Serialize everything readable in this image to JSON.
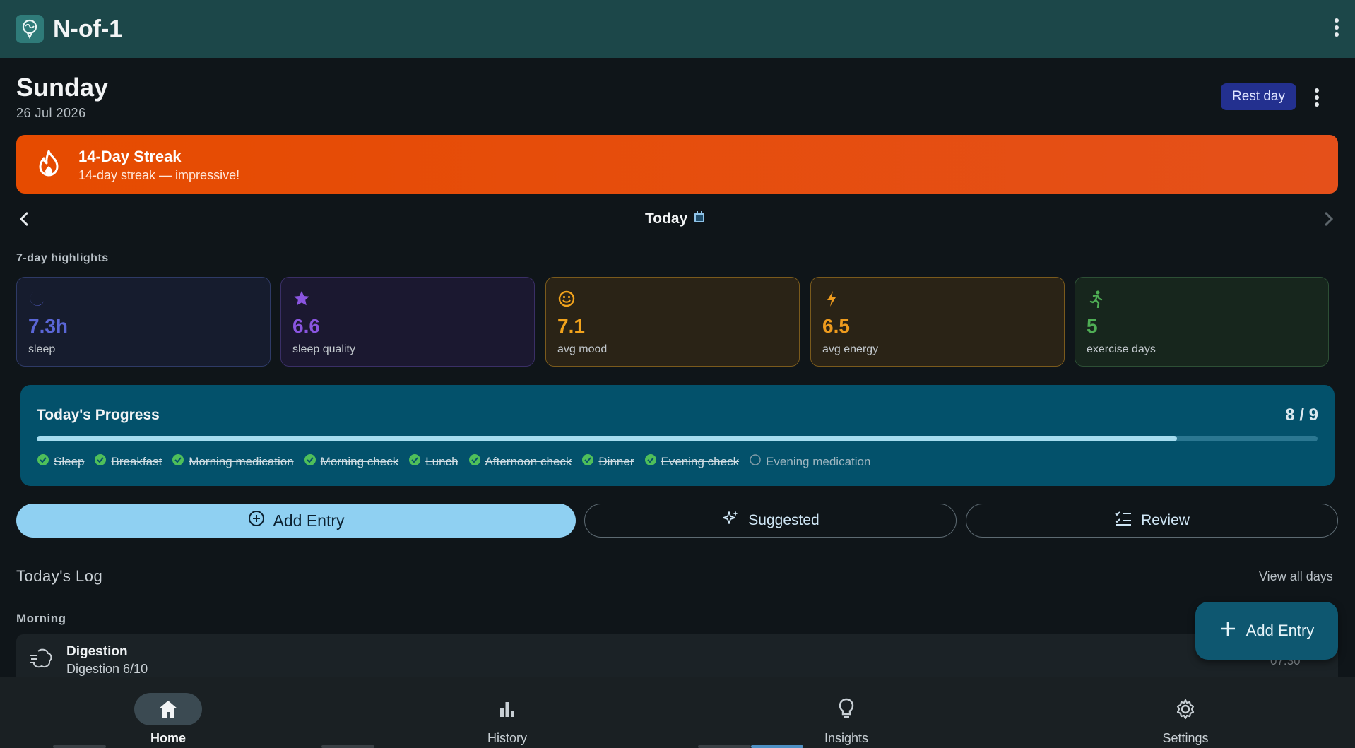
{
  "app": {
    "title": "N-of-1"
  },
  "day": {
    "name": "Sunday",
    "date": "26 Jul 2026",
    "rest_label": "Rest day"
  },
  "streak": {
    "title": "14-Day Streak",
    "subtitle": "14-day streak — impressive!"
  },
  "date_nav": {
    "label": "Today"
  },
  "highlights": {
    "title": "7-day highlights",
    "cards": [
      {
        "icon": "moon-icon",
        "value": "7.3h",
        "label": "sleep",
        "color": "#5a66d6",
        "bg": "#161c2e",
        "border": "#2e3a66"
      },
      {
        "icon": "star-icon",
        "value": "6.6",
        "label": "sleep quality",
        "color": "#8a55e0",
        "bg": "#1b1830",
        "border": "#3a2f66"
      },
      {
        "icon": "smile-icon",
        "value": "7.1",
        "label": "avg mood",
        "color": "#f2a31c",
        "bg": "#2a2316",
        "border": "#7a5a1c"
      },
      {
        "icon": "bolt-icon",
        "value": "6.5",
        "label": "avg energy",
        "color": "#ee9b1e",
        "bg": "#2a2316",
        "border": "#7a5a1c"
      },
      {
        "icon": "running-icon",
        "value": "5",
        "label": "exercise days",
        "color": "#4fae55",
        "bg": "#17261d",
        "border": "#2d4f35"
      }
    ]
  },
  "progress": {
    "title": "Today's Progress",
    "count": "8 / 9",
    "fraction": 0.89,
    "items": [
      {
        "label": "Sleep",
        "done": true
      },
      {
        "label": "Breakfast",
        "done": true
      },
      {
        "label": "Morning medication",
        "done": true
      },
      {
        "label": "Morning check",
        "done": true
      },
      {
        "label": "Lunch",
        "done": true
      },
      {
        "label": "Afternoon check",
        "done": true
      },
      {
        "label": "Dinner",
        "done": true
      },
      {
        "label": "Evening check",
        "done": true
      },
      {
        "label": "Evening medication",
        "done": false
      }
    ]
  },
  "actions": {
    "add_entry": "Add Entry",
    "suggested": "Suggested",
    "review": "Review"
  },
  "log": {
    "title": "Today's Log",
    "view_all": "View all days",
    "section": "Morning",
    "entries": [
      {
        "name": "Digestion",
        "detail": "Digestion 6/10",
        "time": "07:30"
      }
    ]
  },
  "fab": {
    "label": "Add Entry"
  },
  "bottom_nav": [
    {
      "label": "Home",
      "icon": "home-icon",
      "active": true
    },
    {
      "label": "History",
      "icon": "bar-chart-icon",
      "active": false
    },
    {
      "label": "Insights",
      "icon": "lightbulb-icon",
      "active": false
    },
    {
      "label": "Settings",
      "icon": "gear-icon",
      "active": false
    }
  ]
}
